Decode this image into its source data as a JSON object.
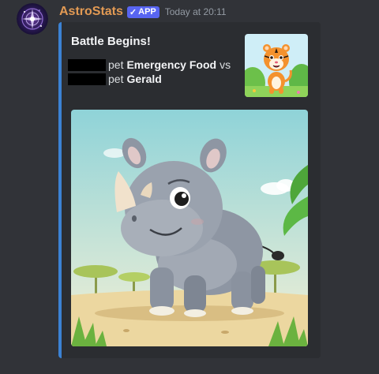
{
  "message": {
    "author": "AstroStats",
    "badge": {
      "check": "✓",
      "label": "APP"
    },
    "timestamp": "Today at 20:11",
    "avatar_icon": "astro-avatar-icon"
  },
  "embed": {
    "accent_color": "#3b82d4",
    "title": "Battle Begins!",
    "lines": [
      {
        "prefix": "pet",
        "pet": "Emergency Food",
        "suffix": "vs"
      },
      {
        "prefix": "pet",
        "pet": "Gerald"
      }
    ],
    "thumbnail_icon": "tiger-cartoon-icon",
    "image_icon": "rhino-cartoon-icon"
  }
}
